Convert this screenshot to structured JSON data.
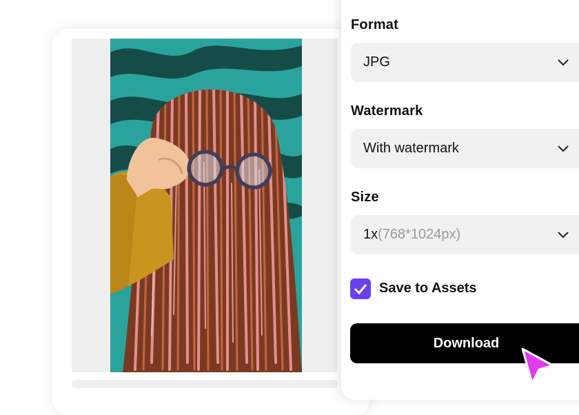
{
  "export_panel": {
    "format": {
      "label": "Format",
      "selected": "JPG"
    },
    "watermark": {
      "label": "Watermark",
      "selected": "With watermark"
    },
    "size": {
      "label": "Size",
      "selected_scale": "1x",
      "selected_dims": "(768*1024px)"
    },
    "save_to_assets": {
      "label": "Save to Assets",
      "checked": true
    },
    "download_button": "Download"
  },
  "icons": {
    "dropdown": "chevron-down-icon",
    "checkbox": "check-icon",
    "cursor": "pointer-cursor-icon"
  },
  "colors": {
    "accent": "#6b3ff0",
    "cursor": "#e13cf0",
    "button_bg": "#000000",
    "field_bg": "#f1f1f2"
  }
}
